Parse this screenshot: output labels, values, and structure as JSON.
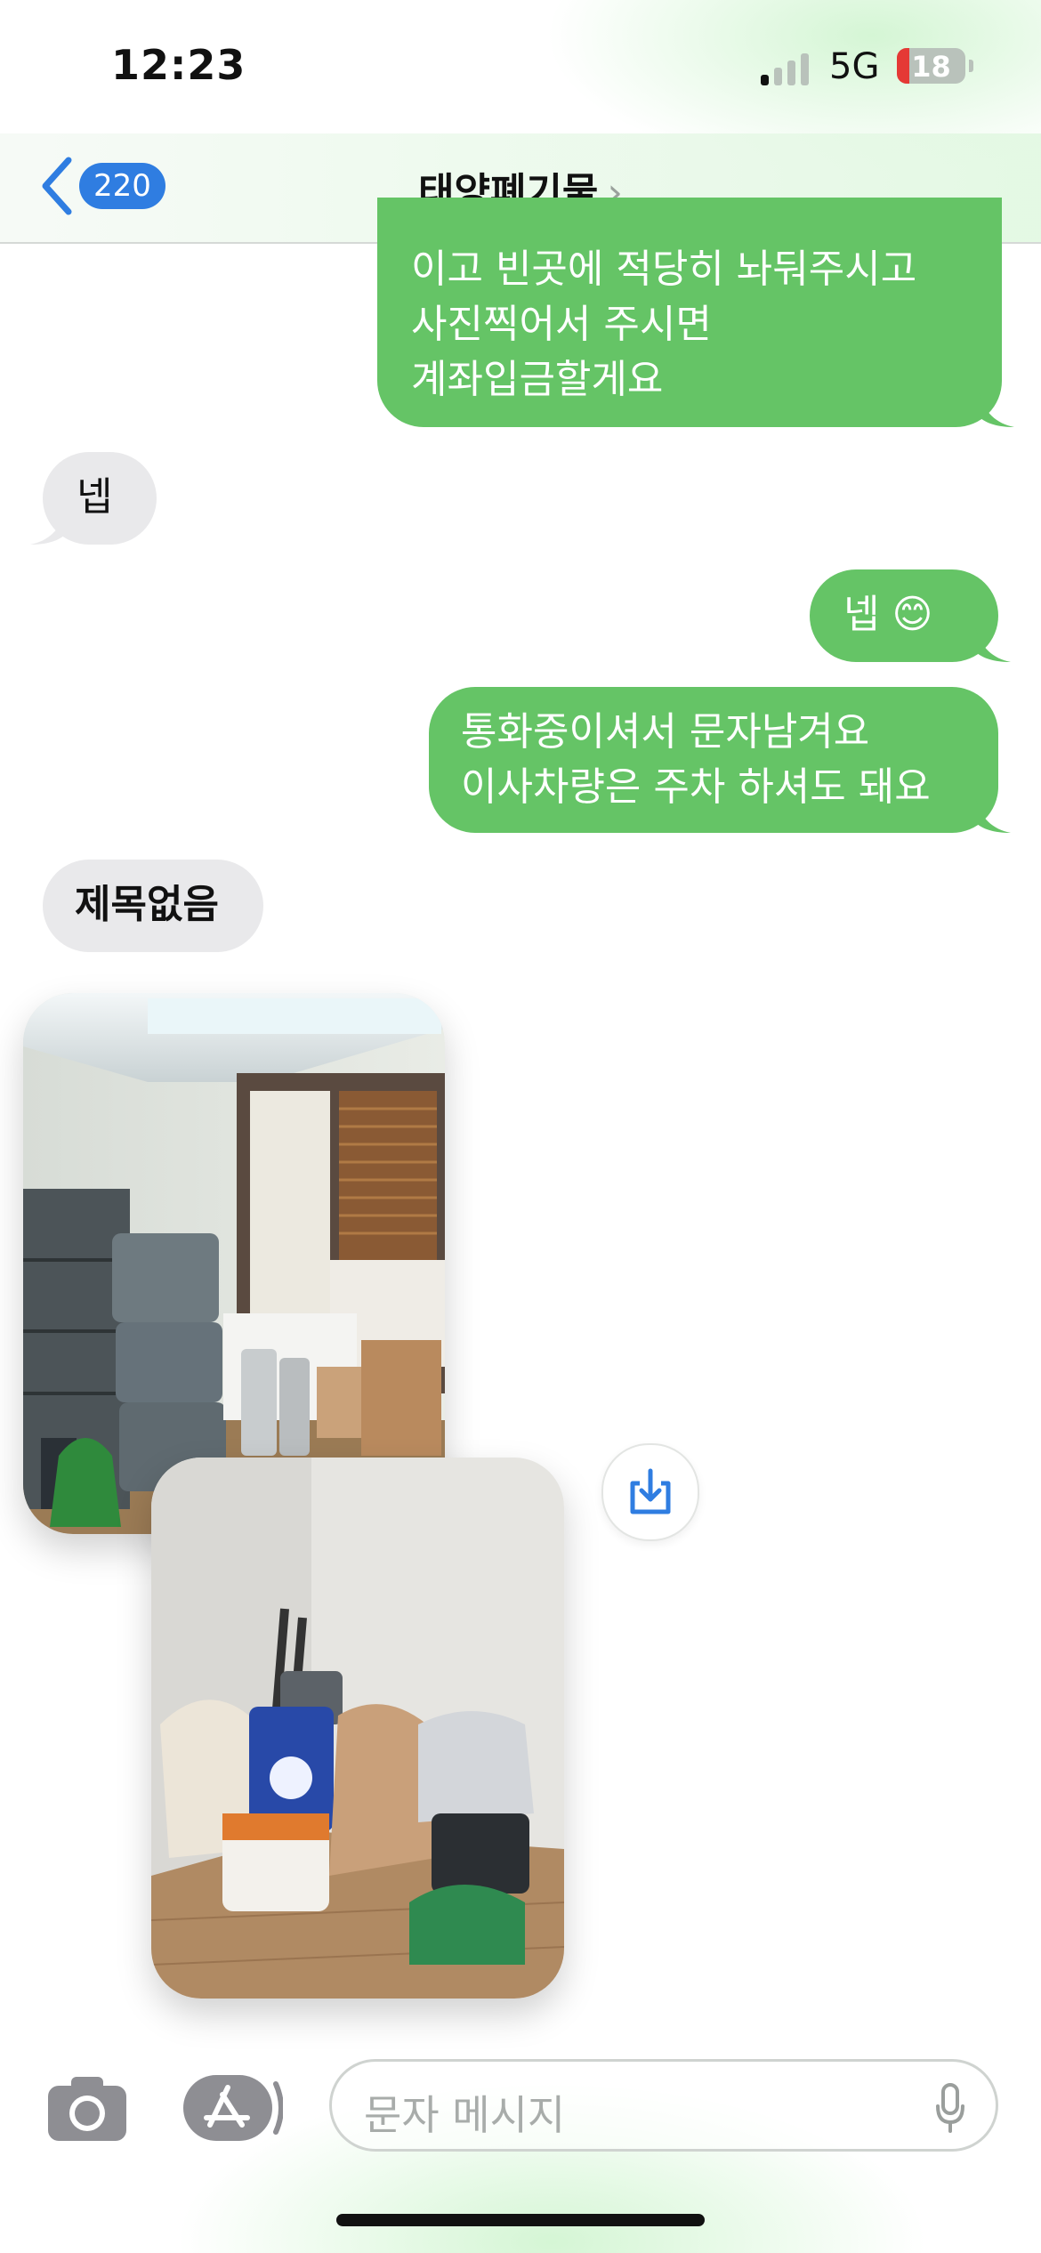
{
  "status_bar": {
    "time": "12:23",
    "network": "5G",
    "battery": "18",
    "battery_level_percent": 18
  },
  "header": {
    "back_badge": "220",
    "title": "태양폐기물",
    "title_chevron": "›"
  },
  "messages": [
    {
      "direction": "sent",
      "lines": [
        "이고 빈곳에 적당히 놔둬주시고",
        "사진찍어서 주시면",
        "계좌입금할게요"
      ]
    },
    {
      "direction": "received",
      "text": "넵"
    },
    {
      "direction": "sent",
      "text": "넵 😊"
    },
    {
      "direction": "sent",
      "lines": [
        "통화중이셔서 문자남겨요",
        "이사차량은 주차 하셔도 돼요"
      ]
    },
    {
      "direction": "received",
      "text": "제목없음"
    }
  ],
  "photos": [
    {
      "icon": "room-photo-icon",
      "description_hidden": true
    },
    {
      "icon": "corner-photo-icon",
      "description_hidden": true
    }
  ],
  "composer": {
    "placeholder": "문자 메시지",
    "camera_icon": "camera-icon",
    "apps_icon": "app-store-icon",
    "mic_icon": "microphone-icon"
  },
  "colors": {
    "sent_bubble": "#65c466",
    "received_bubble": "#e9e9eb",
    "accent_blue": "#2f7de1"
  }
}
